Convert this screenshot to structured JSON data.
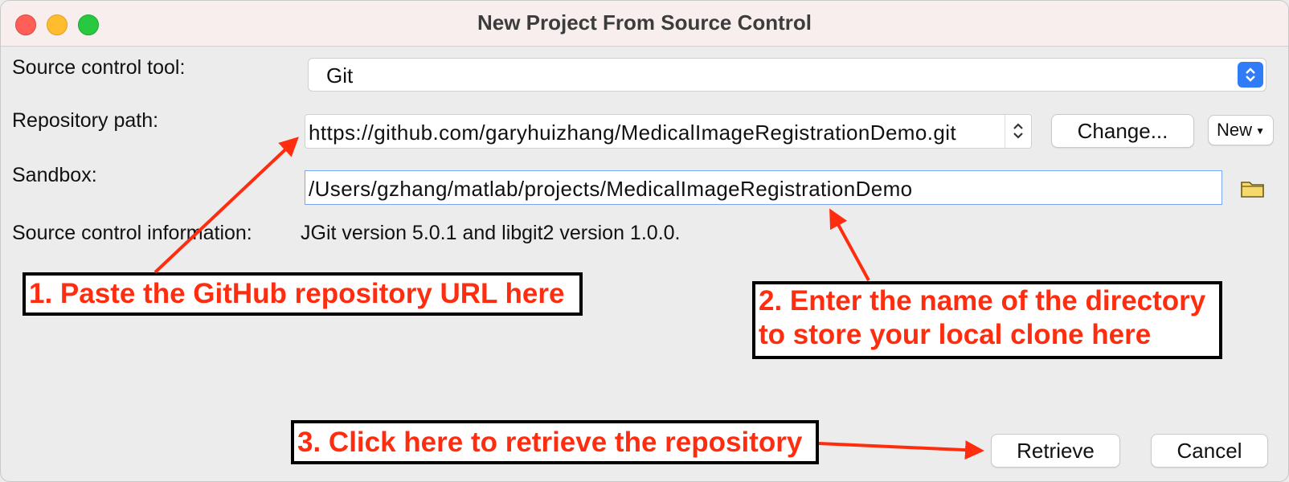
{
  "window": {
    "title": "New Project From Source Control"
  },
  "labels": {
    "source_control_tool": "Source control tool:",
    "repository_path": "Repository path:",
    "sandbox": "Sandbox:",
    "source_control_information": "Source control information:"
  },
  "source_control_tool": {
    "selected": "Git"
  },
  "repository_path": {
    "value": "https://github.com/garyhuizhang/MedicalImageRegistrationDemo.git"
  },
  "buttons": {
    "change": "Change...",
    "new": "New",
    "retrieve": "Retrieve",
    "cancel": "Cancel"
  },
  "sandbox": {
    "value": "/Users/gzhang/matlab/projects/MedicalImageRegistrationDemo"
  },
  "source_control_information": {
    "value": "JGit version 5.0.1 and libgit2 version 1.0.0."
  },
  "annotations": {
    "step1": "1. Paste the GitHub repository URL here",
    "step2_line1": "2. Enter the name of the directory",
    "step2_line2": "to store your local clone here",
    "step3": "3. Click here to retrieve the repository"
  },
  "icons": [
    "close-icon",
    "minimize-icon",
    "maximize-icon",
    "select-arrows-icon",
    "combo-arrows-icon",
    "caret-down-icon",
    "folder-icon"
  ],
  "colors": {
    "accent": "#2f7cf6",
    "annotation_text": "#ff2d10",
    "arrow": "#ff2d10"
  }
}
